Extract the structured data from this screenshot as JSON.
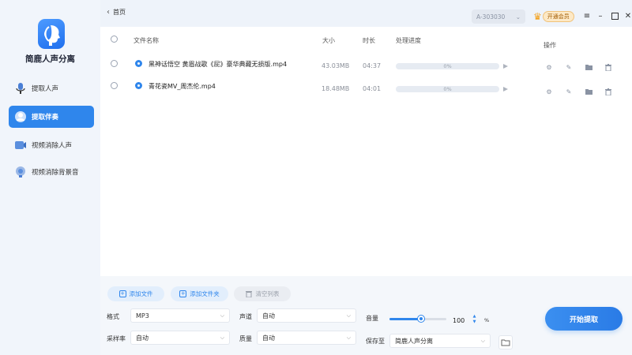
{
  "app": {
    "title": "简鹿人声分离"
  },
  "sidebar": {
    "items": [
      {
        "label": "提取人声",
        "icon": "microphone-icon",
        "active": false
      },
      {
        "label": "提取伴奏",
        "icon": "accompaniment-icon",
        "active": true
      },
      {
        "label": "视频消除人声",
        "icon": "video-icon",
        "active": false
      },
      {
        "label": "视频消除背景音",
        "icon": "speaker-icon",
        "active": false
      }
    ]
  },
  "header": {
    "back_label": "首页",
    "account_id": "A-303030",
    "vip_label": "开通会员"
  },
  "table": {
    "columns": {
      "name": "文件名称",
      "size": "大小",
      "duration": "时长",
      "progress": "处理进度",
      "actions": "操作"
    },
    "rows": [
      {
        "name": "黑神话悟空 黄眉战歌《屁》豪华典藏无损版.mp4",
        "size": "43.03MB",
        "duration": "04:37",
        "progress": 0,
        "progress_label": "0%"
      },
      {
        "name": "青花瓷MV_周杰伦.mp4",
        "size": "18.48MB",
        "duration": "04:01",
        "progress": 0,
        "progress_label": "0%"
      }
    ]
  },
  "toolbar": {
    "add_file": "添加文件",
    "add_folder": "添加文件夹",
    "clear_list": "清空列表"
  },
  "settings": {
    "format_label": "格式",
    "format_value": "MP3",
    "channel_label": "声道",
    "channel_value": "自动",
    "volume_label": "音量",
    "volume_value": "100",
    "volume_level": 0.55,
    "volume_unit": "%",
    "samplerate_label": "采样率",
    "samplerate_value": "自动",
    "quality_label": "质量",
    "quality_value": "自动",
    "save_label": "保存至",
    "save_value": "简鹿人声分离"
  },
  "start_button": "开始提取",
  "colors": {
    "accent": "#2f86ec",
    "vip": "#f3a01a"
  }
}
